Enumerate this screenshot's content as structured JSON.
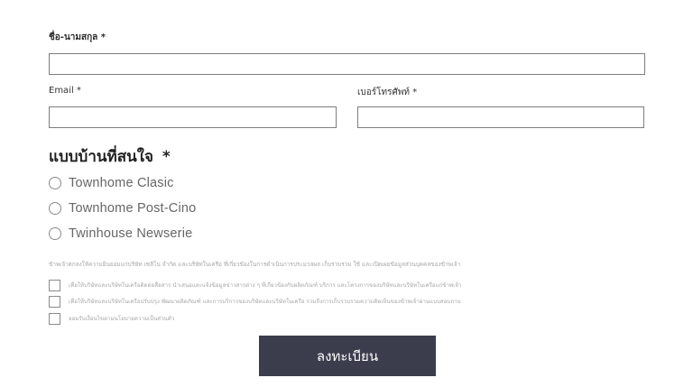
{
  "form": {
    "fullname_label": "ชื่อ-นามสกุล *",
    "fullname_value": "",
    "email_label": "Email *",
    "email_value": "",
    "phone_label": "เบอร์โทรศัพท์ *",
    "phone_value": "",
    "house_type": {
      "title": "แบบบ้านที่สนใจ",
      "required_mark": "*",
      "options": [
        {
          "label": "Townhome Clasic",
          "selected": false
        },
        {
          "label": "Townhome Post-Cino",
          "selected": false
        },
        {
          "label": "Twinhouse Newserie",
          "selected": false
        }
      ]
    },
    "consent": {
      "intro": "ข้าพเจ้าตกลงให้ความยินยอมแก่บริษัท เซลีโน จำกัด และบริษัทในเครือ ที่เกี่ยวข้องในการดำเนินการประมวลผล เก็บรวบรวม ใช้ และเปิดเผยข้อมูลส่วนบุคคลของข้าพเจ้า",
      "items": [
        {
          "label": "เพื่อให้บริษัทและบริษัทในเครือติดต่อสื่อสาร นำเสนอและแจ้งข้อมูลข่าวสารต่าง ๆ ที่เกี่ยวข้องกับผลิตภัณฑ์ บริการ และโครงการของบริษัทและบริษัทในเครือแก่ข้าพเจ้า",
          "checked": false
        },
        {
          "label": "เพื่อให้บริษัทและบริษัทในเครือปรับปรุง พัฒนาผลิตภัณฑ์ และการบริการของบริษัทและบริษัทในเครือ รวมถึงการเก็บรวบรวมความคิดเห็นของข้าพเจ้าผ่านแบบสอบถาม",
          "checked": false
        },
        {
          "label": "ยอมรับเงื่อนไขตามนโยบายความเป็นส่วนตัว",
          "checked": false
        }
      ]
    },
    "submit_label": "ลงทะเบียน"
  }
}
